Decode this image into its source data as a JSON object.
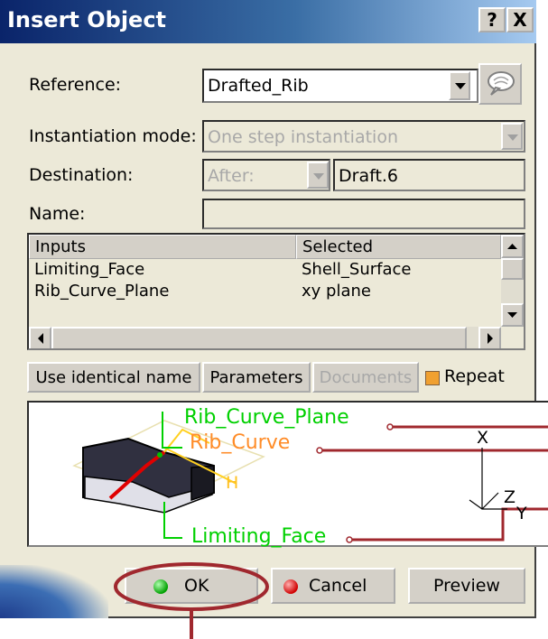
{
  "window": {
    "title": "Insert Object",
    "help_label": "?",
    "close_label": "X"
  },
  "form": {
    "reference_label": "Reference:",
    "reference_value": "Drafted_Rib",
    "instantiation_label": "Instantiation mode:",
    "instantiation_value": "One step instantiation",
    "destination_label": "Destination:",
    "destination_position": "After:",
    "destination_value": "Draft.6",
    "name_label": "Name:",
    "name_value": ""
  },
  "table": {
    "headers": [
      "Inputs",
      "Selected"
    ],
    "rows": [
      [
        "Limiting_Face",
        "Shell_Surface"
      ],
      [
        "Rib_Curve_Plane",
        "xy plane"
      ]
    ]
  },
  "buttons_row": {
    "use_identical": "Use identical name",
    "parameters": "Parameters",
    "documents": "Documents",
    "repeat": "Repeat"
  },
  "preview": {
    "label_rib_curve_plane": "Rib_Curve_Plane",
    "label_rib_curve": "Rib_Curve",
    "label_limiting_face": "Limiting_Face",
    "axis_x": "X",
    "axis_y": "Y",
    "axis_z": "Z",
    "dim_h": "H"
  },
  "footer": {
    "ok": "OK",
    "cancel": "Cancel",
    "preview": "Preview"
  },
  "colors": {
    "accent_red": "#A0282E",
    "preview_green": "#00D000",
    "preview_orange": "#FF8C28"
  }
}
